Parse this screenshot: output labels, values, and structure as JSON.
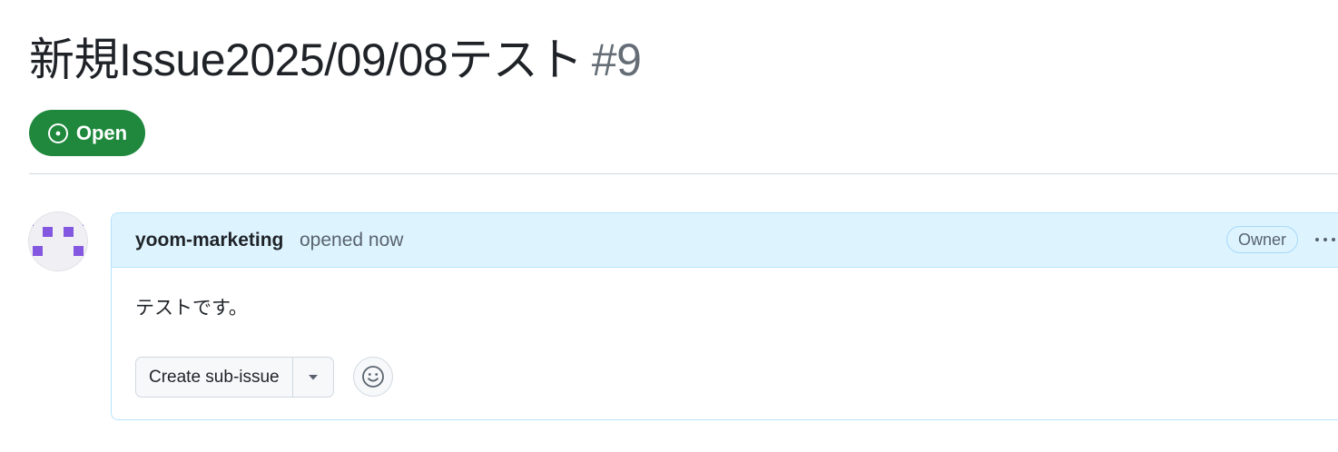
{
  "issue": {
    "title": "新規Issue2025/09/08テスト",
    "number": "#9",
    "state": "Open",
    "state_color": "#1f883d"
  },
  "comment": {
    "author": "yoom-marketing",
    "opened_text": "opened now",
    "author_badge": "Owner",
    "body": "テストです。",
    "header_bg": "#ddf4ff"
  },
  "actions": {
    "create_sub_issue_label": "Create sub-issue",
    "icons": {
      "state": "issue-opened-icon",
      "caret": "triangle-down-icon",
      "reaction": "smiley-icon",
      "more": "kebab-horizontal-icon",
      "avatar": "identicon"
    }
  }
}
